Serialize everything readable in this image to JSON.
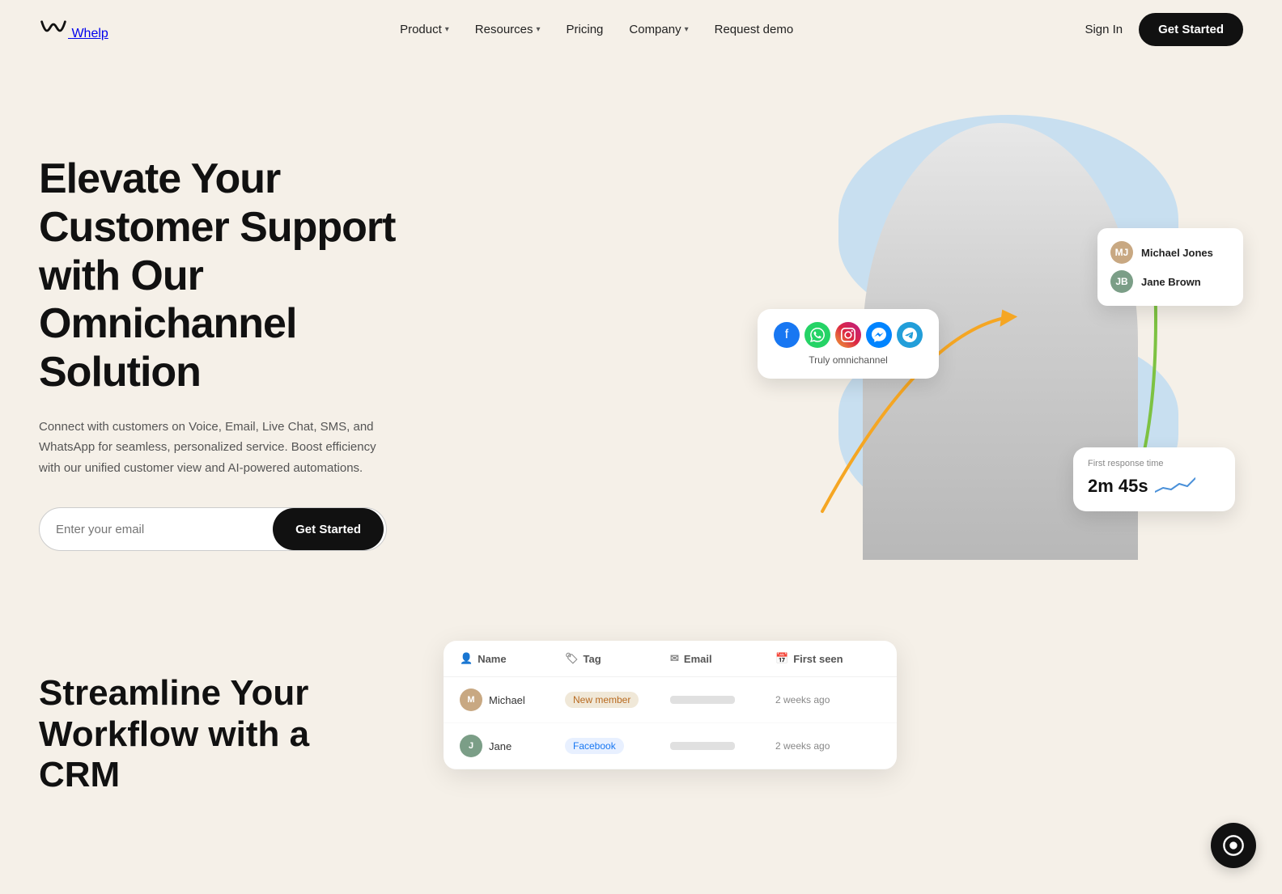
{
  "brand": {
    "name": "Whelp",
    "logo_alt": "Whelp logo"
  },
  "nav": {
    "links": [
      {
        "label": "Product",
        "has_dropdown": true
      },
      {
        "label": "Resources",
        "has_dropdown": true
      },
      {
        "label": "Pricing",
        "has_dropdown": false
      },
      {
        "label": "Company",
        "has_dropdown": true
      },
      {
        "label": "Request demo",
        "has_dropdown": false
      }
    ],
    "sign_in": "Sign In",
    "get_started": "Get Started"
  },
  "hero": {
    "title": "Elevate Your Customer Support with Our Omnichannel Solution",
    "subtitle": "Connect with customers on Voice, Email, Live Chat, SMS, and WhatsApp for seamless, personalized service. Boost efficiency with our unified customer view and AI-powered automations.",
    "email_placeholder": "Enter your email",
    "cta_label": "Get Started",
    "omni_card": {
      "label": "Truly omnichannel",
      "icons": [
        "fb",
        "wa",
        "ig",
        "ms",
        "tg"
      ]
    },
    "agents_card": {
      "agent1": "Michael Jones",
      "agent2": "Jane Brown"
    },
    "response_card": {
      "label": "First response time",
      "value": "2m 45s"
    }
  },
  "section2": {
    "title": "Streamline Your Workflow with a CRM",
    "table": {
      "headers": [
        "Name",
        "Tag",
        "Email",
        "First seen"
      ],
      "rows": [
        {
          "name": "Michael",
          "tag": "New member",
          "tag_class": "default",
          "first_seen": "2 weeks ago"
        },
        {
          "name": "Jane",
          "tag": "Facebook",
          "tag_class": "fb",
          "first_seen": "2 weeks ago"
        }
      ]
    }
  },
  "float_btn": {
    "label": "Chat"
  }
}
